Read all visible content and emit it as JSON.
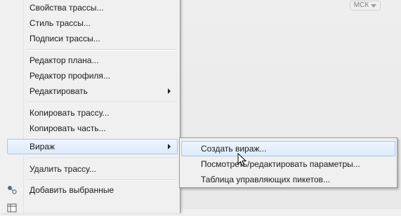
{
  "canvas": {
    "ucs_label": "МСК"
  },
  "menu": {
    "items": [
      {
        "label": "Свойства трассы..."
      },
      {
        "label": "Стиль трассы..."
      },
      {
        "label": "Подписи трассы..."
      },
      {
        "label": "Редактор плана..."
      },
      {
        "label": "Редактор профиля..."
      },
      {
        "label": "Редактировать",
        "submenu_arrow": true
      },
      {
        "label": "Копировать трассу..."
      },
      {
        "label": "Копировать часть..."
      },
      {
        "label": "Вираж",
        "submenu_arrow": true,
        "highlighted": true
      },
      {
        "label": "Удалить трассу..."
      },
      {
        "label": "Добавить выбранные",
        "icon": "add-selected-icon"
      }
    ]
  },
  "submenu": {
    "items": [
      {
        "label": "Создать вираж...",
        "highlighted": true
      },
      {
        "label": "Посмотреть/редактировать параметры..."
      },
      {
        "label": "Таблица управляющих пикетов..."
      }
    ]
  },
  "colors": {
    "menu_bg": "#f0f0f0",
    "highlight_border": "#a9c8ea",
    "highlight_fill": "#dcebfc",
    "canvas_bg": "#ececec"
  }
}
